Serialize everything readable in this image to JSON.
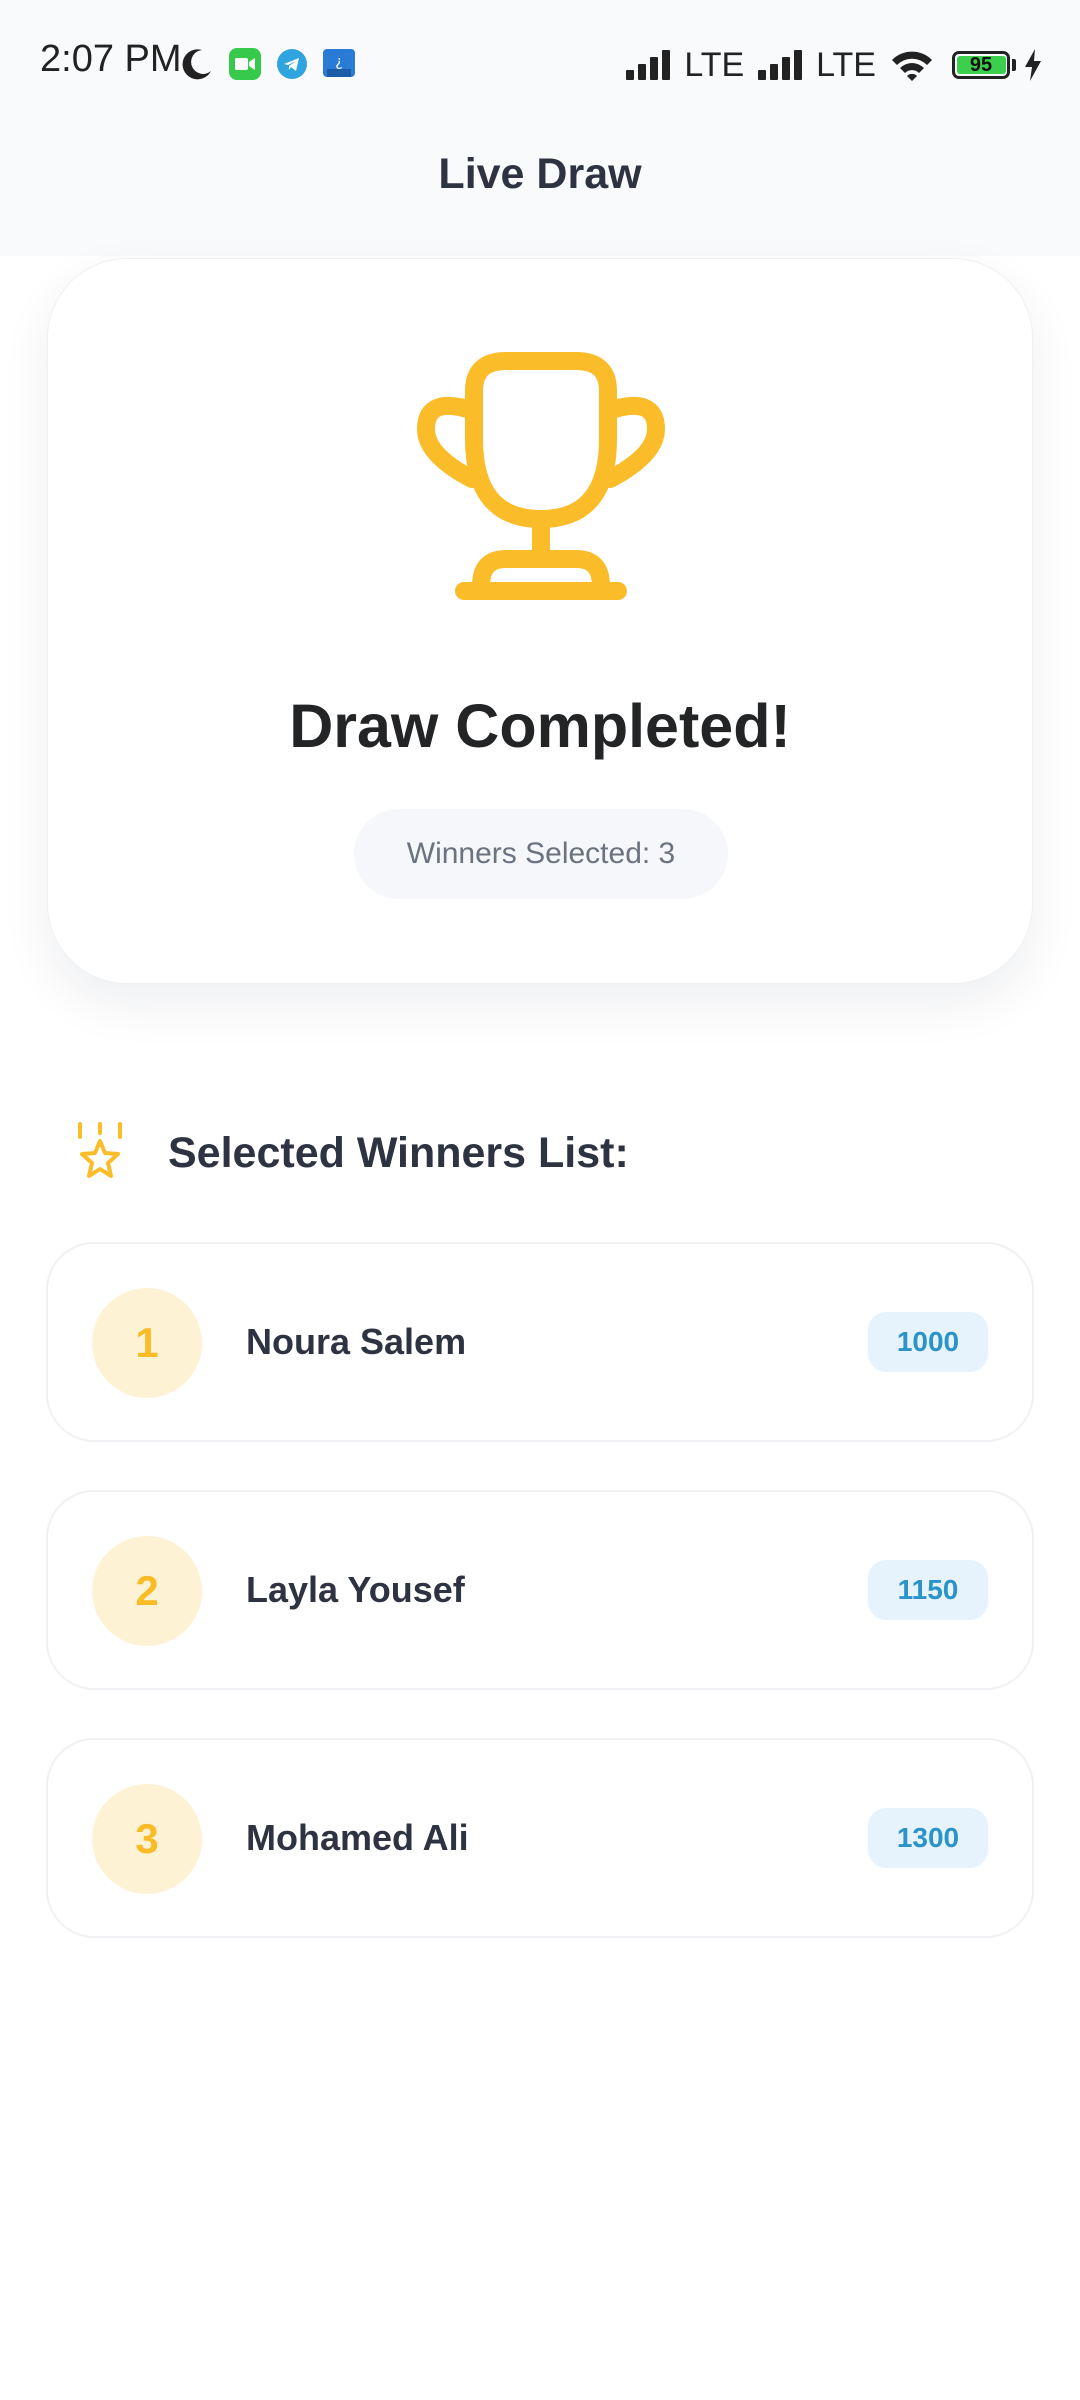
{
  "status_bar": {
    "time": "2:07 PM",
    "network_1": "LTE",
    "network_2": "LTE",
    "battery_level": "95",
    "icons": [
      "moon-icon",
      "facetime-icon",
      "telegram-icon",
      "app-icon",
      "signal-icon",
      "wifi-icon",
      "battery-icon",
      "charging-icon"
    ]
  },
  "header": {
    "title": "Live Draw"
  },
  "result": {
    "title": "Draw Completed!",
    "winners_selected": "Winners Selected: 3",
    "icon": "trophy-icon"
  },
  "winners_section": {
    "title": "Selected Winners List:",
    "icon": "star-award-icon",
    "winners": [
      {
        "rank": "1",
        "name": "Noura Salem",
        "score": "1000"
      },
      {
        "rank": "2",
        "name": "Layla Yousef",
        "score": "1150"
      },
      {
        "rank": "3",
        "name": "Mohamed Ali",
        "score": "1300"
      }
    ]
  },
  "colors": {
    "accent": "#fbbc2a",
    "rank_bg": "#fef2d5",
    "score_text": "#2a93c9",
    "score_bg": "#e6f3fc",
    "title_text": "#2d3340"
  }
}
